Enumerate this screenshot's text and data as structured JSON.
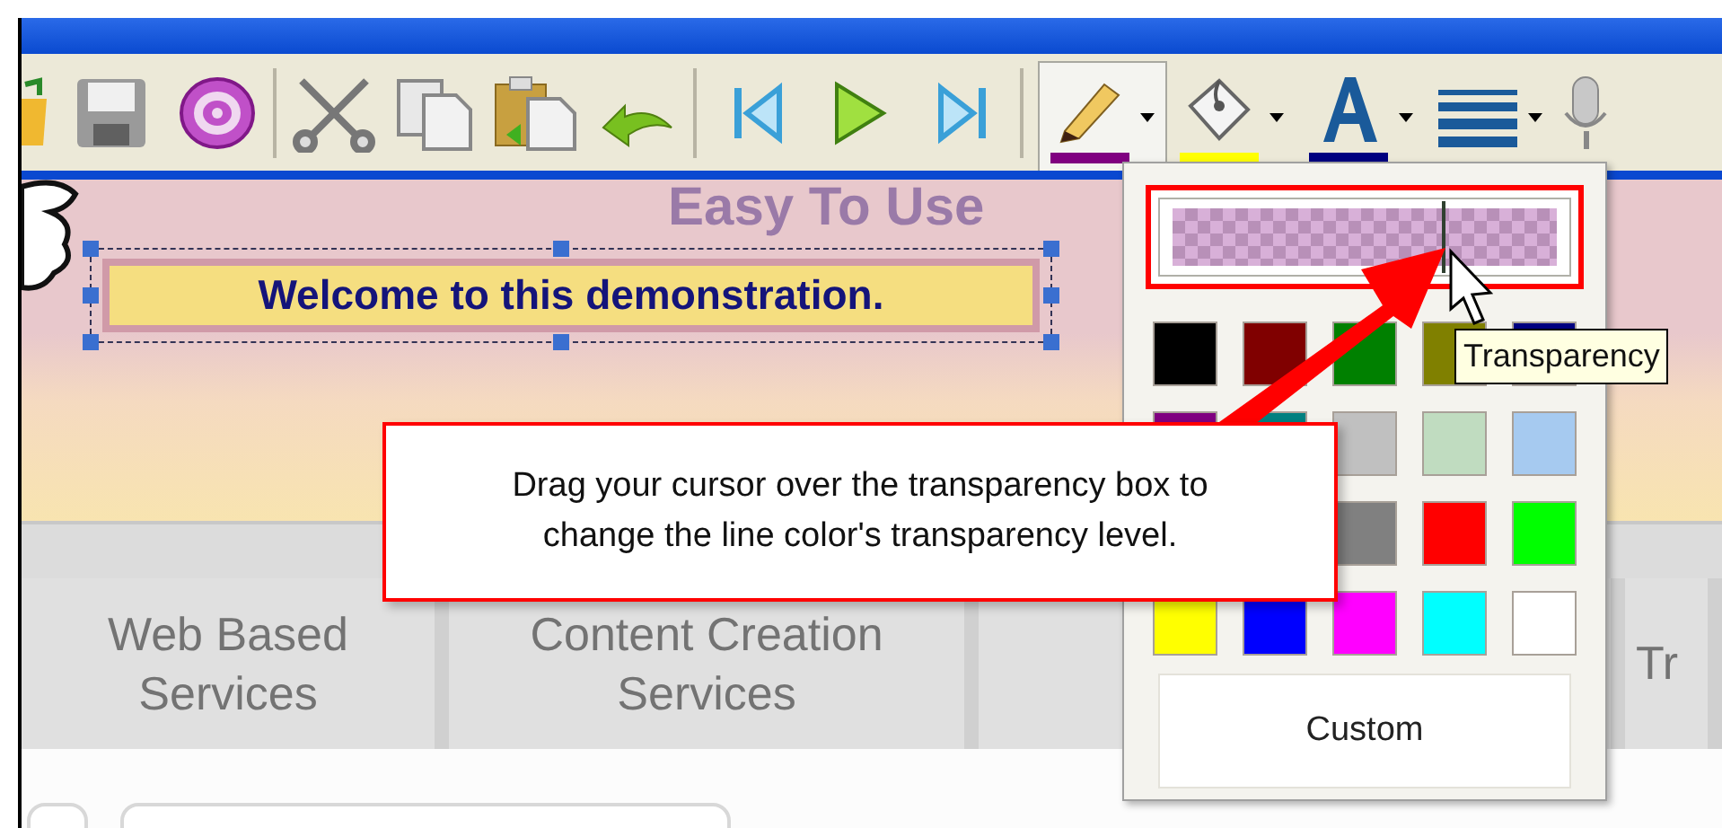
{
  "toolbar": {
    "color_tools": [
      {
        "kind": "pencil",
        "color": "#800080",
        "selected": true
      },
      {
        "kind": "bucket",
        "color": "#ffff00",
        "selected": false
      },
      {
        "kind": "font",
        "color": "#000080",
        "selected": false
      }
    ]
  },
  "banner": {
    "heading": "Easy To Use",
    "welcome": "Welcome to this demonstration."
  },
  "nav_tabs": [
    {
      "label": "Web Based Services"
    },
    {
      "label": "Content Creation Services"
    },
    {
      "label": "Tr"
    }
  ],
  "color_menu": {
    "transparency": {
      "level": 0.7
    },
    "swatch_rows": [
      [
        {
          "color": "#000000"
        },
        {
          "color": "#800000"
        },
        {
          "color": "#008000"
        },
        {
          "color": "#808000"
        },
        {
          "color": "#000080"
        }
      ],
      [
        {
          "color": "#800080"
        },
        {
          "color": "#008080"
        },
        {
          "color": "#c0c0c0"
        },
        {
          "color": "#c0dcc0"
        },
        {
          "color": "#a6caf0"
        }
      ],
      [
        {
          "color": "#808080"
        },
        {
          "color": "#ff0000"
        },
        {
          "color": "#00ff00"
        }
      ],
      [
        {
          "color": "#ffff00"
        },
        {
          "color": "#0000ff"
        },
        {
          "color": "#ff00ff"
        },
        {
          "color": "#00ffff"
        },
        {
          "color": "#ffffff"
        }
      ]
    ],
    "custom": "Custom"
  },
  "tooltip": "Transparency",
  "callout": {
    "text": "Drag your cursor over the transparency box to change the line color's transparency level."
  }
}
